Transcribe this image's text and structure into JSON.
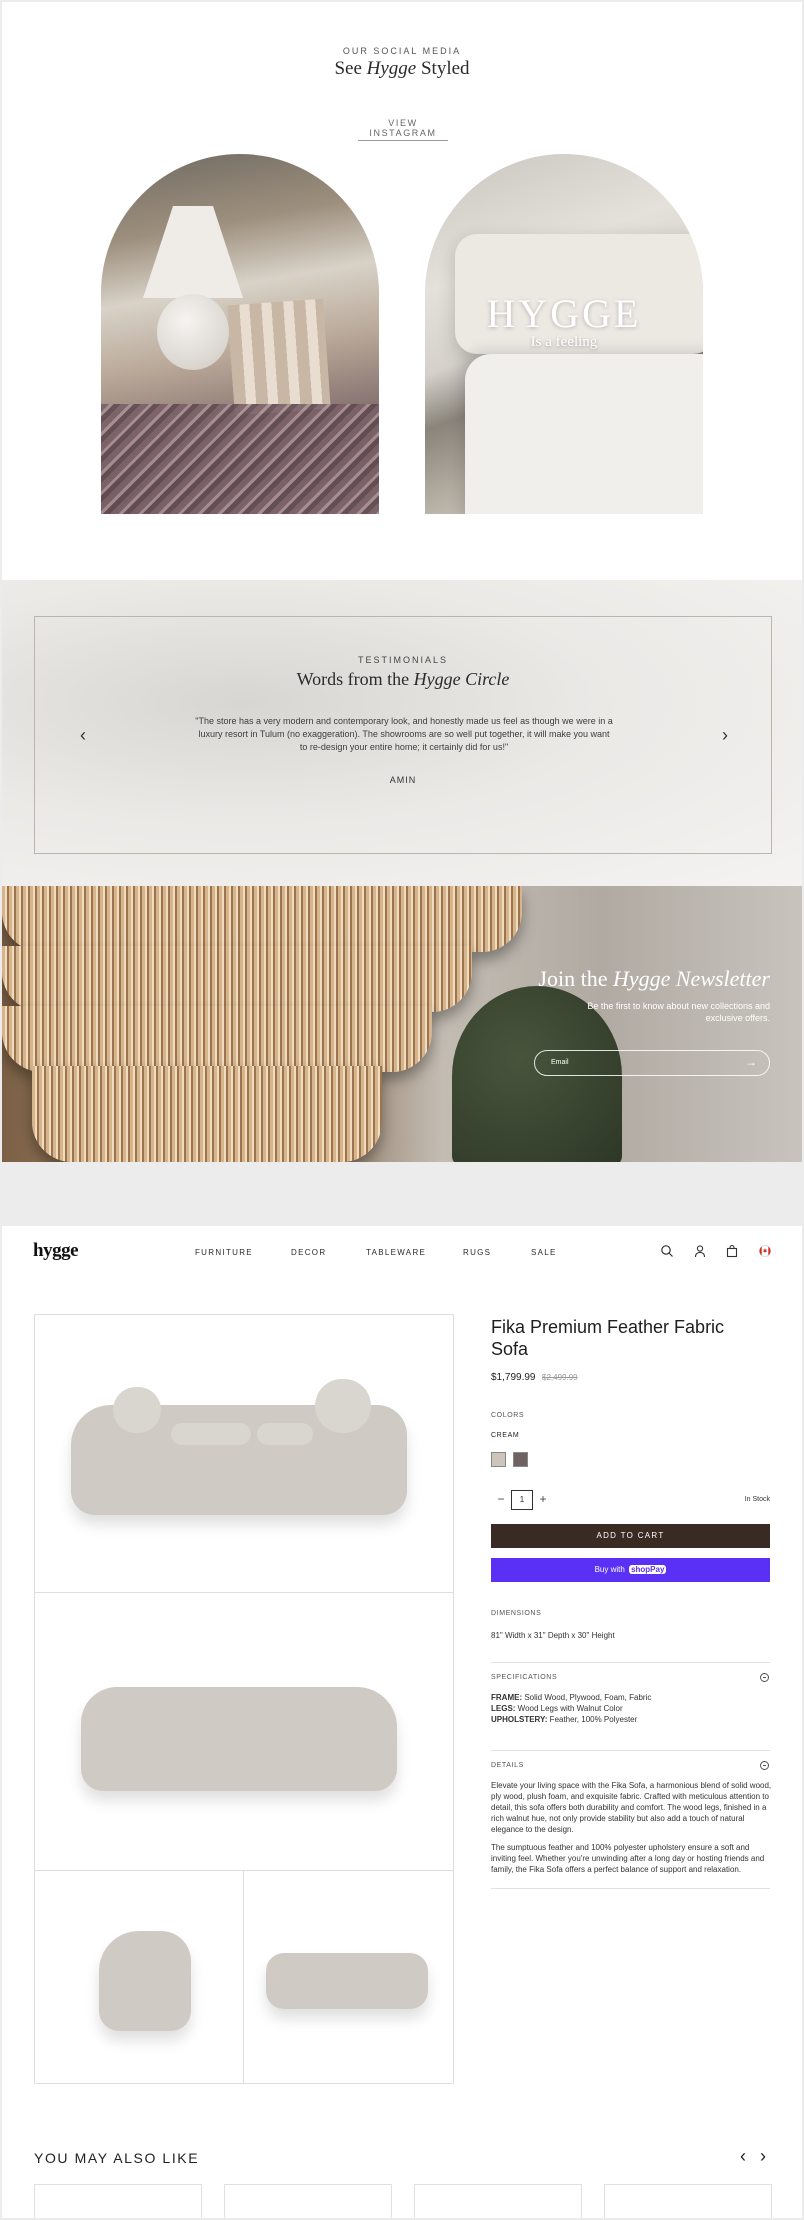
{
  "social": {
    "kicker": "OUR SOCIAL MEDIA",
    "title_a": "See ",
    "title_em": "Hygge",
    "title_b": " Styled",
    "cta": "VIEW INSTAGRAM",
    "overlay_title": "HYGGE",
    "overlay_sub": "Is a feeling"
  },
  "testimonials": {
    "kicker": "TESTIMONIALS",
    "title_a": "Words from the ",
    "title_em": "Hygge Circle",
    "quote": "\"The store has a very modern and contemporary look, and honestly made us feel as though we were in a luxury resort in Tulum (no exaggeration). The showrooms are so well put together, it will make you want to re-design your entire home; it certainly did for us!\"",
    "author": "AMIN",
    "prev": "‹",
    "next": "›"
  },
  "newsletter": {
    "title_a": "Join the ",
    "title_em": "Hygge Newsletter",
    "sub": "Be the first to know about new collections and exclusive offers.",
    "placeholder": "Email",
    "submit": "→"
  },
  "header": {
    "logo": "hygge",
    "nav": [
      "FURNITURE",
      "DECOR",
      "TABLEWARE",
      "RUGS",
      "SALE"
    ]
  },
  "product": {
    "name": "Fika Premium Feather Fabric Sofa",
    "price": "$1,799.99",
    "compare_price": "$2,499.99",
    "colors_label": "COLORS",
    "selected_color": "CREAM",
    "swatches": [
      "#cdc5bc",
      "#6e6362"
    ],
    "qty": "1",
    "qty_minus": "−",
    "qty_plus": "+",
    "stock": "In Stock",
    "add_to_cart": "ADD TO CART",
    "buy_with": "Buy with",
    "shop_pay_a": "shop",
    "shop_pay_b": "Pay",
    "dimensions_label": "DIMENSIONS",
    "dimensions": "81\" Width x 31\" Depth x 30\" Height",
    "specs_label": "SPECIFICATIONS",
    "specs": [
      {
        "k": "FRAME:",
        "v": " Solid Wood, Plywood, Foam, Fabric"
      },
      {
        "k": "LEGS:",
        "v": " Wood Legs with Walnut Color"
      },
      {
        "k": "UPHOLSTERY:",
        "v": " Feather, 100% Polyester"
      }
    ],
    "details_label": "DETAILS",
    "details_p1": "Elevate your living space with the Fika Sofa, a harmonious blend of solid wood, ply wood, plush foam, and exquisite fabric. Crafted with meticulous attention to detail, this sofa offers both durability and comfort. The wood legs, finished in a rich walnut hue, not only provide stability but also add a touch of natural elegance to the design.",
    "details_p2": "The sumptuous feather and 100% polyester upholstery ensure a soft and inviting feel. Whether you're unwinding after a long day or hosting friends and family, the Fika Sofa offers a perfect balance of support and relaxation."
  },
  "related": {
    "title": "YOU MAY ALSO LIKE",
    "prev": "‹",
    "next": "›"
  }
}
